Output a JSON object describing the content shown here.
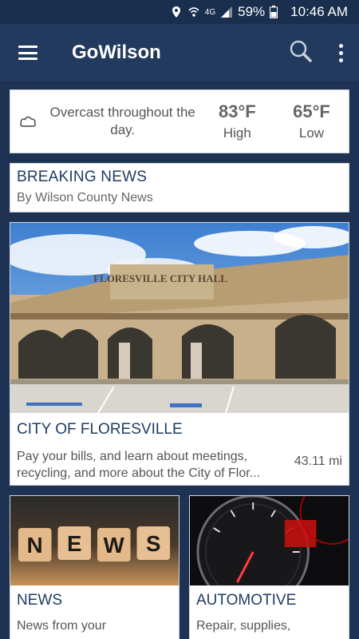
{
  "status_bar": {
    "network": "4G",
    "battery": "59%",
    "time": "10:46 AM"
  },
  "app_bar": {
    "title": "GoWilson",
    "icons": [
      "menu-icon",
      "search-icon",
      "more-vert-icon"
    ]
  },
  "weather": {
    "icon": "cloud-icon",
    "description": "Overcast throughout the day.",
    "high_value": "83°F",
    "high_label": "High",
    "low_value": "65°F",
    "low_label": "Low"
  },
  "breaking": {
    "title": "BREAKING NEWS",
    "subtitle": "By Wilson County News"
  },
  "feature": {
    "sign_text": "FLORESVILLE CITY HALL",
    "title": "CITY OF FLORESVILLE",
    "description": "Pay your bills, and learn about meetings, recycling, and more about the City of Flor...",
    "distance": "43.11 mi"
  },
  "tiles": [
    {
      "image_text": "NEWS",
      "title": "NEWS",
      "description": "News from your"
    },
    {
      "title": "AUTOMOTIVE",
      "description": "Repair, supplies,"
    }
  ],
  "colors": {
    "background": "#1e3353",
    "app_bar": "#213a5e",
    "heading_text": "#1f3c63"
  }
}
